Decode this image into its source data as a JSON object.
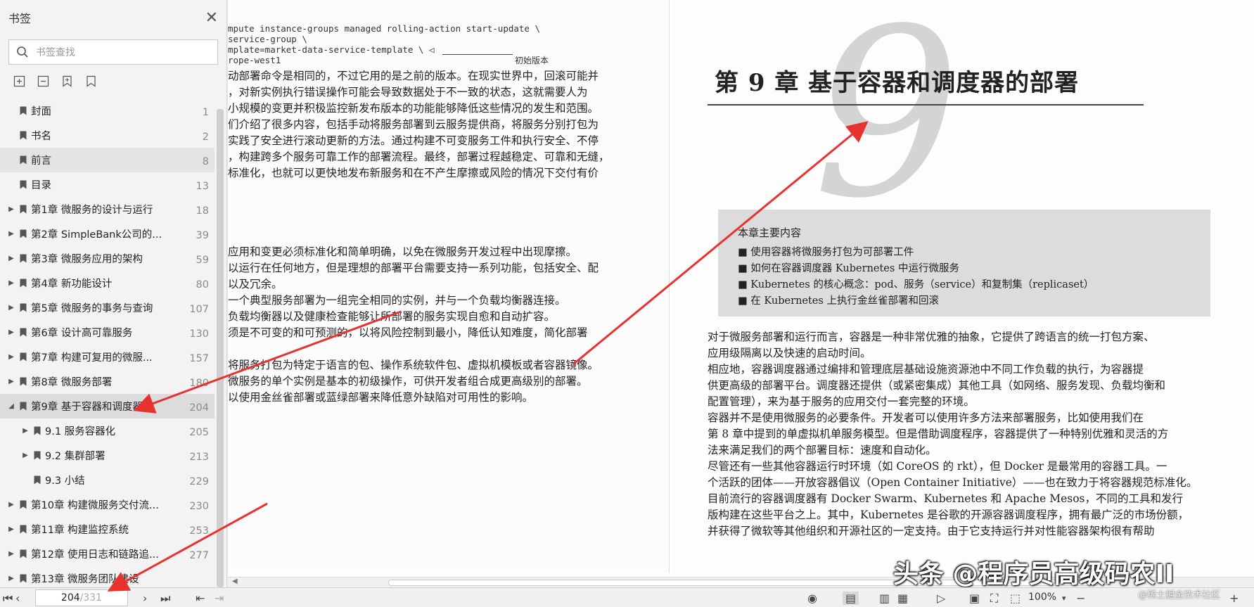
{
  "sidebar": {
    "title": "书签",
    "search_placeholder": "书签查找",
    "items": [
      {
        "label": "封面",
        "page": "1",
        "level": 0,
        "expandable": false
      },
      {
        "label": "书名",
        "page": "2",
        "level": 0,
        "expandable": false
      },
      {
        "label": "前言",
        "page": "8",
        "level": 0,
        "expandable": false
      },
      {
        "label": "目录",
        "page": "13",
        "level": 0,
        "expandable": false
      },
      {
        "label": "第1章 微服务的设计与运行",
        "page": "18",
        "level": 0,
        "expandable": true
      },
      {
        "label": "第2章 SimpleBank公司的...",
        "page": "39",
        "level": 0,
        "expandable": true
      },
      {
        "label": "第3章 微服务应用的架构",
        "page": "59",
        "level": 0,
        "expandable": true
      },
      {
        "label": "第4章 新功能设计",
        "page": "80",
        "level": 0,
        "expandable": true
      },
      {
        "label": "第5章 微服务的事务与查询",
        "page": "107",
        "level": 0,
        "expandable": true
      },
      {
        "label": "第6章 设计高可靠服务",
        "page": "130",
        "level": 0,
        "expandable": true
      },
      {
        "label": "第7章 构建可复用的微服...",
        "page": "157",
        "level": 0,
        "expandable": true
      },
      {
        "label": "第8章 微服务部署",
        "page": "180",
        "level": 0,
        "expandable": true
      },
      {
        "label": "第9章 基于容器和调度器...",
        "page": "204",
        "level": 0,
        "expandable": true,
        "expanded": true
      },
      {
        "label": "9.1 服务容器化",
        "page": "205",
        "level": 1,
        "expandable": true
      },
      {
        "label": "9.2 集群部署",
        "page": "213",
        "level": 1,
        "expandable": true
      },
      {
        "label": "9.3 小结",
        "page": "229",
        "level": 1,
        "expandable": false
      },
      {
        "label": "第10章 构建微服务交付流...",
        "page": "230",
        "level": 0,
        "expandable": true
      },
      {
        "label": "第11章 构建监控系统",
        "page": "253",
        "level": 0,
        "expandable": true
      },
      {
        "label": "第12章 使用日志和链路追...",
        "page": "277",
        "level": 0,
        "expandable": true
      },
      {
        "label": "第13章 微服务团队建设",
        "page": "",
        "level": 0,
        "expandable": true
      }
    ]
  },
  "left_page": {
    "code": [
      "mpute instance-groups managed rolling-action start-update \\",
      "service-group \\",
      "mplate=market-data-service-template \\ ◁",
      "rope-west1"
    ],
    "annotation": "初始版本",
    "para1": [
      "动部署命令是相同的，不过它用的是之前的版本。在现实世界中，回滚可能并",
      "，对新实例执行错误操作可能会导致数据处于不一致的状态，这就需要人为",
      "小规模的变更并积极监控新发布版本的功能能够降低这些情况的发生和范围。",
      "们介绍了很多内容，包括手动将服务部署到云服务提供商，将服务分别打包为",
      "实践了安全进行滚动更新的方法。通过构建不可变服务工件和执行安全、不停",
      "，构建跨多个服务可靠工作的部署流程。最终，部署过程越稳定、可靠和无缝，",
      "标准化，也就可以更快地发布新服务和在不产生摩擦或风险的情况下交付有价"
    ],
    "para2": [
      "应用和变更必须标准化和简单明确，以免在微服务开发过程中出现摩擦。",
      "以运行在任何地方，但是理想的部署平台需要支持一系列功能，包括安全、配",
      "以及冗余。",
      "一个典型服务部署为一组完全相同的实例，并与一个负载均衡器连接。",
      "负载均衡器以及健康检查能够让所部署的服务实现自愈和自动扩容。",
      "须是不可变的和可预测的，以将风险控制到最小，降低认知难度，简化部署",
      "",
      "将服务打包为特定于语言的包、操作系统软件包、虚拟机模板或者容器镜像。",
      "微服务的单个实例是基本的初级操作，可供开发者组合成更高级别的部署。",
      "以使用金丝雀部署或蓝绿部署来降低意外缺陷对可用性的影响。"
    ]
  },
  "right_page": {
    "big_numeral": "9",
    "chapter_title": "第 9 章   基于容器和调度器的部署",
    "box_title": "本章主要内容",
    "box_items": [
      "■ 使用容器将微服务打包为可部署工件",
      "■ 如何在容器调度器 Kubernetes 中运行微服务",
      "■ Kubernetes 的核心概念：pod、服务（service）和复制集（replicaset）",
      "■ 在 Kubernetes 上执行金丝雀部署和回滚"
    ],
    "paragraphs": [
      "    对于微服务部署和运行而言，容器是一种非常优雅的抽象，它提供了跨语言的统一打包方案、",
      "应用级隔离以及快速的启动时间。",
      "    相应地，容器调度器通过编排和管理底层基础设施资源池中不同工作负载的执行，为容器提",
      "供更高级的部署平台。调度器还提供（或紧密集成）其他工具（如网络、服务发现、负载均衡和",
      "配置管理），来为基于服务的应用交付一套完整的环境。",
      "    容器并不是使用微服务的必要条件。开发者可以使用许多方法来部署服务，比如使用我们在",
      "第 8 章中提到的单虚拟机单服务模型。但是借助调度程序，容器提供了一种特别优雅和灵活的方",
      "法来满足我们的两个部署目标：速度和自动化。",
      "    尽管还有一些其他容器运行时环境（如 CoreOS 的 rkt），但 Docker 是最常用的容器工具。一",
      "个活跃的团体——开放容器倡议（Open Container Initiative）——也在致力于将容器规范标准化。",
      "    目前流行的容器调度器有 Docker Swarm、Kubernetes 和 Apache Mesos，不同的工具和发行",
      "版构建在这些平台之上。其中，Kubernetes 是谷歌的开源容器调度程序，拥有最广泛的市场份额，",
      "并获得了微软等其他组织和开源社区的一定支持。由于它支持运行并对性能容器架构很有帮助"
    ]
  },
  "statusbar": {
    "current_page": "204",
    "total_pages": "/331",
    "zoom": "100%"
  },
  "watermark": {
    "main": "头条 @程序员高级码农II",
    "sub": "@稀土掘金技术社区"
  },
  "colors": {
    "arrow": "#e8322f",
    "sidebar_bg": "#f3f3f3",
    "active_item": "#dcdcdc"
  }
}
